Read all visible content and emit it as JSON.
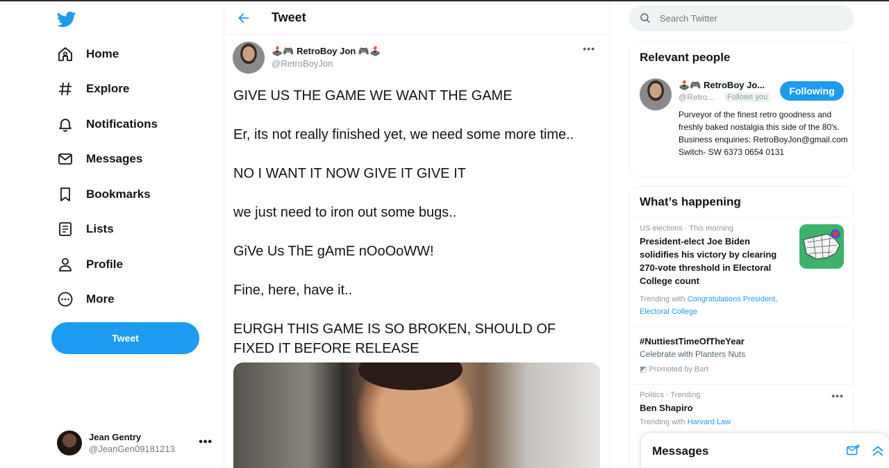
{
  "nav": {
    "items": [
      {
        "label": "Home",
        "icon": "home-icon"
      },
      {
        "label": "Explore",
        "icon": "hashtag-icon"
      },
      {
        "label": "Notifications",
        "icon": "bell-icon"
      },
      {
        "label": "Messages",
        "icon": "envelope-icon"
      },
      {
        "label": "Bookmarks",
        "icon": "bookmark-icon"
      },
      {
        "label": "Lists",
        "icon": "list-icon"
      },
      {
        "label": "Profile",
        "icon": "person-icon"
      },
      {
        "label": "More",
        "icon": "more-circle-icon"
      }
    ],
    "tweet_button": "Tweet"
  },
  "account": {
    "name": "Jean Gentry",
    "handle": "@JeanGen09181213",
    "more": "•••"
  },
  "header": {
    "title": "Tweet"
  },
  "tweet": {
    "author_name": "🕹️🎮 RetroBoy Jon 🎮🕹️",
    "author_handle": "@RetroBoyJon",
    "more": "•••",
    "lines": [
      "GIVE US THE GAME WE WANT THE GAME",
      "Er, its not really finished yet, we need some more time..",
      "NO I WANT IT NOW GIVE IT GIVE IT",
      "we just need to iron out some bugs..",
      "GiVe Us ThE gAmE nOoOoWW!",
      "Fine, here, have it..",
      "EURGH THIS GAME IS SO BROKEN, SHOULD OF FIXED IT BEFORE RELEASE"
    ]
  },
  "search": {
    "placeholder": "Search Twitter"
  },
  "relevant": {
    "title": "Relevant people",
    "name": "🕹️🎮 RetroBoy Jo...",
    "handle": "@Retro...",
    "follows_you": "Follows you",
    "button": "Following",
    "bio": "Purveyor of the finest retro goodness and freshly baked nostalgia this side of the 80's. Business enquiries: RetroBoyJon@gmail.com Switch- SW 6373 0654 0131"
  },
  "happening": {
    "title": "What’s happening",
    "trends": [
      {
        "meta": "US elections · This morning",
        "title": "President-elect Joe Biden solidifies his victory by clearing 270-vote threshold in Electoral College count",
        "trending_prefix": "Trending with ",
        "trending_links": "Congratulations President, Electoral College"
      },
      {
        "title": "#NuttiestTimeOfTheYear",
        "sub": "Celebrate with Planters Nuts",
        "promoted": "Promoted by Bart"
      },
      {
        "meta": "Politics · Trending",
        "title": "Ben Shapiro",
        "trending_prefix": "Trending with ",
        "trending_links": "Harvard Law",
        "more": "•••"
      }
    ]
  },
  "messages_dock": {
    "title": "Messages"
  },
  "colors": {
    "accent": "#1d9bf0",
    "text": "#0f1419",
    "muted": "#536471"
  }
}
